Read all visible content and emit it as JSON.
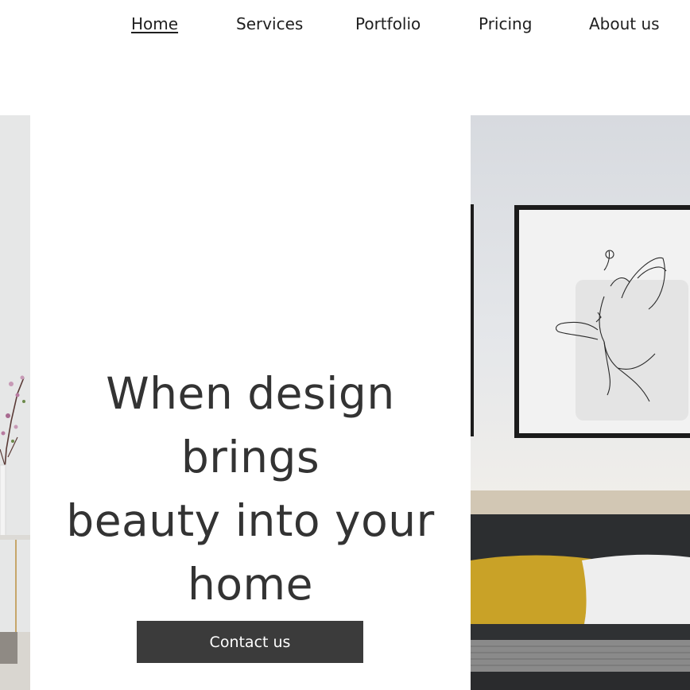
{
  "nav": {
    "items": [
      {
        "label": "Home",
        "active": true
      },
      {
        "label": "Services",
        "active": false
      },
      {
        "label": "Portfolio",
        "active": false
      },
      {
        "label": "Pricing",
        "active": false
      },
      {
        "label": "About us",
        "active": false
      }
    ]
  },
  "hero": {
    "headline_line1": "When design brings",
    "headline_line2": "beauty into your",
    "headline_line3": "home",
    "cta_label": "Contact us"
  },
  "colors": {
    "text": "#333333",
    "button_bg": "#3b3b3b",
    "button_text": "#ffffff",
    "accent_pillow": "#c9a227"
  }
}
